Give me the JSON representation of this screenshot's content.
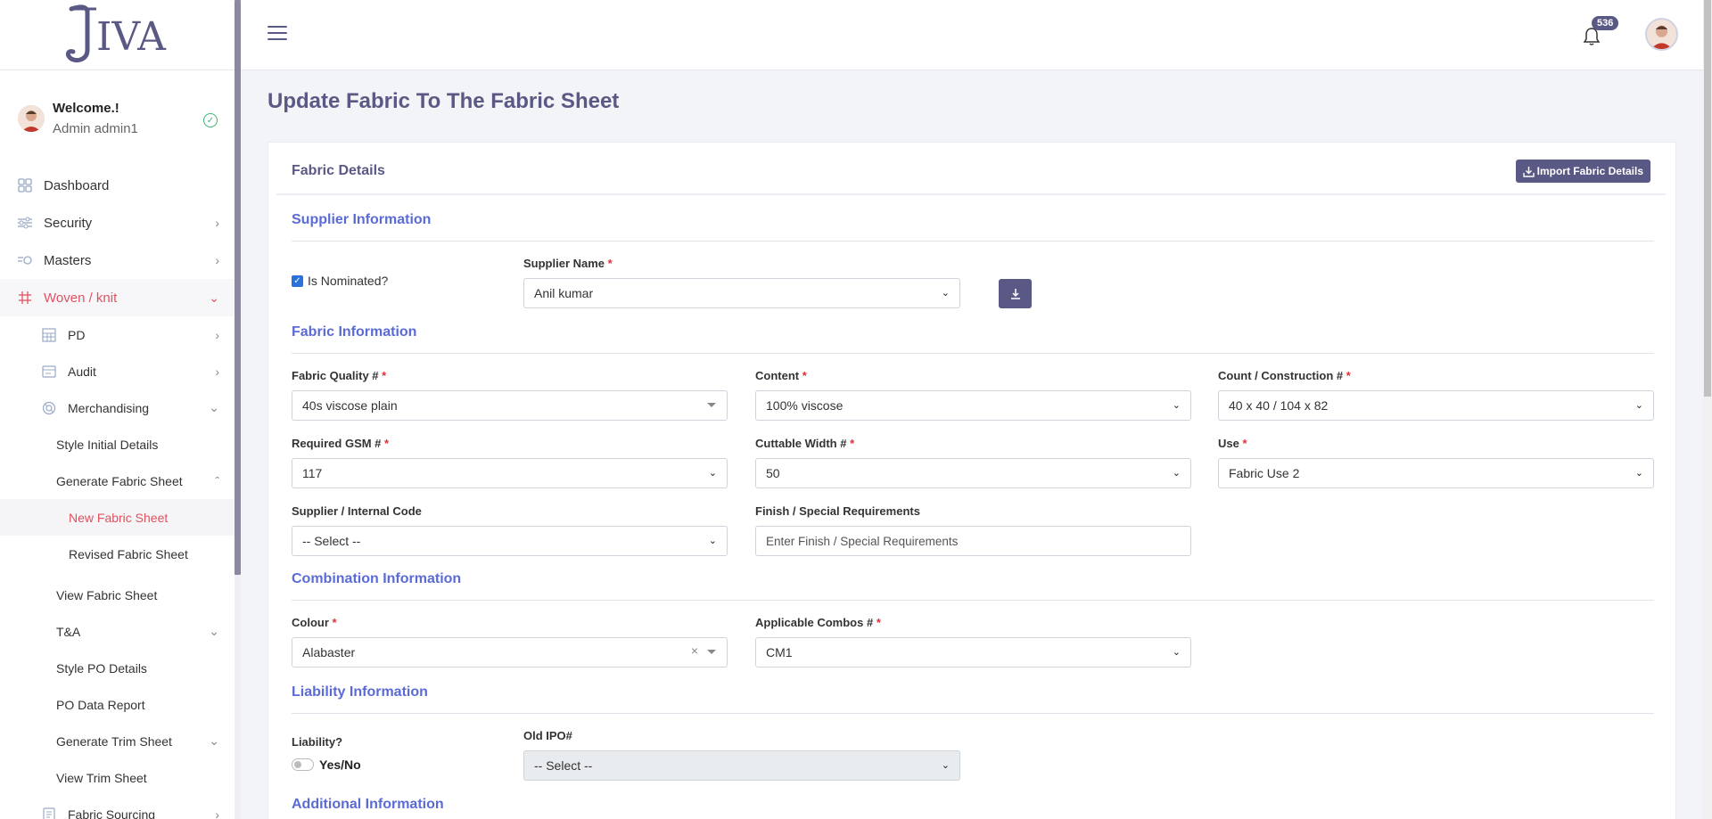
{
  "app": {
    "logo_text": "JIVA"
  },
  "user": {
    "welcome": "Welcome.!",
    "name": "Admin admin1"
  },
  "sidebar": {
    "items": [
      {
        "label": "Dashboard"
      },
      {
        "label": "Security"
      },
      {
        "label": "Masters"
      },
      {
        "label": "Woven / knit"
      },
      {
        "label": "PD"
      },
      {
        "label": "Audit"
      },
      {
        "label": "Merchandising"
      },
      {
        "label": "Style Initial Details"
      },
      {
        "label": "Generate Fabric Sheet"
      },
      {
        "label": "New Fabric Sheet"
      },
      {
        "label": "Revised Fabric Sheet"
      },
      {
        "label": "View Fabric Sheet"
      },
      {
        "label": "T&A"
      },
      {
        "label": "Style PO Details"
      },
      {
        "label": "PO Data Report"
      },
      {
        "label": "Generate Trim Sheet"
      },
      {
        "label": "View Trim Sheet"
      },
      {
        "label": "Fabric Sourcing"
      }
    ]
  },
  "topbar": {
    "notification_count": "536"
  },
  "page": {
    "title": "Update Fabric To The Fabric Sheet"
  },
  "card": {
    "title": "Fabric Details",
    "import_button": "Import Fabric Details"
  },
  "sections": {
    "supplier": "Supplier Information",
    "fabric": "Fabric Information",
    "combination": "Combination Information",
    "liability": "Liability Information",
    "additional": "Additional Information"
  },
  "form": {
    "is_nominated": {
      "label": "Is Nominated?",
      "checked": true
    },
    "supplier_name": {
      "label": "Supplier Name",
      "value": "Anil kumar"
    },
    "fabric_quality": {
      "label": "Fabric Quality #",
      "value": "40s viscose plain"
    },
    "content": {
      "label": "Content",
      "value": "100% viscose"
    },
    "count_construction": {
      "label": "Count / Construction #",
      "value": "40 x 40 / 104 x 82"
    },
    "required_gsm": {
      "label": "Required GSM #",
      "value": "117"
    },
    "cuttable_width": {
      "label": "Cuttable Width #",
      "value": "50"
    },
    "use": {
      "label": "Use",
      "value": "Fabric Use 2"
    },
    "supplier_internal_code": {
      "label": "Supplier / Internal Code",
      "value": "-- Select --"
    },
    "finish": {
      "label": "Finish / Special Requirements",
      "placeholder": "Enter Finish / Special Requirements"
    },
    "colour": {
      "label": "Colour ",
      "value": "Alabaster"
    },
    "applicable_combos": {
      "label": "Applicable Combos #",
      "value": "CM1"
    },
    "liability": {
      "label": "Liability?",
      "toggle_label": "Yes/No"
    },
    "old_ipo": {
      "label": "Old IPO#",
      "value": "-- Select --"
    }
  },
  "required_marker": "*"
}
